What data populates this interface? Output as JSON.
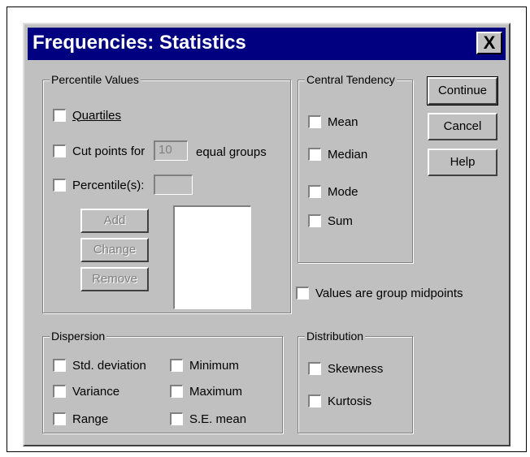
{
  "dialog": {
    "title": "Frequencies: Statistics",
    "close_label": "X"
  },
  "percentile_values": {
    "title": "Percentile Values",
    "quartiles": "Quartiles",
    "cut_points_label": "Cut points for",
    "cut_points_value": "10",
    "cut_points_suffix": "equal groups",
    "percentiles_label": "Percentile(s):",
    "percentiles_value": "",
    "add": "Add",
    "change": "Change",
    "remove": "Remove"
  },
  "central_tendency": {
    "title": "Central Tendency",
    "mean": "Mean",
    "median": "Median",
    "mode": "Mode",
    "sum": "Sum"
  },
  "buttons": {
    "continue": "Continue",
    "cancel": "Cancel",
    "help": "Help"
  },
  "group_midpoints": "Values are group midpoints",
  "dispersion": {
    "title": "Dispersion",
    "std_deviation": "Std. deviation",
    "variance": "Variance",
    "range": "Range",
    "minimum": "Minimum",
    "maximum": "Maximum",
    "se_mean": "S.E. mean"
  },
  "distribution": {
    "title": "Distribution",
    "skewness": "Skewness",
    "kurtosis": "Kurtosis"
  },
  "colors": {
    "title_bar": "#000080",
    "dialog_face": "#c0c0c0"
  }
}
